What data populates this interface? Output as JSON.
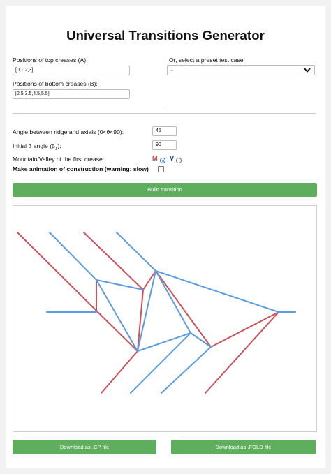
{
  "title": "Universal Transitions Generator",
  "top_creases": {
    "label": "Positions of top creases (A):",
    "value": "[0,1,2,3]"
  },
  "bottom_creases": {
    "label": "Positions of bottom creases (B):",
    "value": "[2.5,3.5,4.5,5.5]"
  },
  "preset": {
    "label": "Or, select a preset test case:",
    "selected": "-"
  },
  "angle": {
    "label": "Angle between ridge and axials (0<θ<90):",
    "value": "45"
  },
  "initial_beta": {
    "label_prefix": "Initial β angle (β",
    "label_sub": "1",
    "label_suffix": "):",
    "value": "90"
  },
  "mountain_valley": {
    "label": "Mountain/Valley of the first crease:",
    "m": "M",
    "v": "V",
    "selected": "M"
  },
  "animation": {
    "label": "Make animation of construction (warning: slow)",
    "checked": false
  },
  "build_button": "Build transition",
  "download_cp": "Download as .CP file",
  "download_fold": "Download as .FOLD file",
  "colors": {
    "mountain": "#d0505a",
    "valley": "#5b9de0",
    "button": "#5fae5d"
  }
}
